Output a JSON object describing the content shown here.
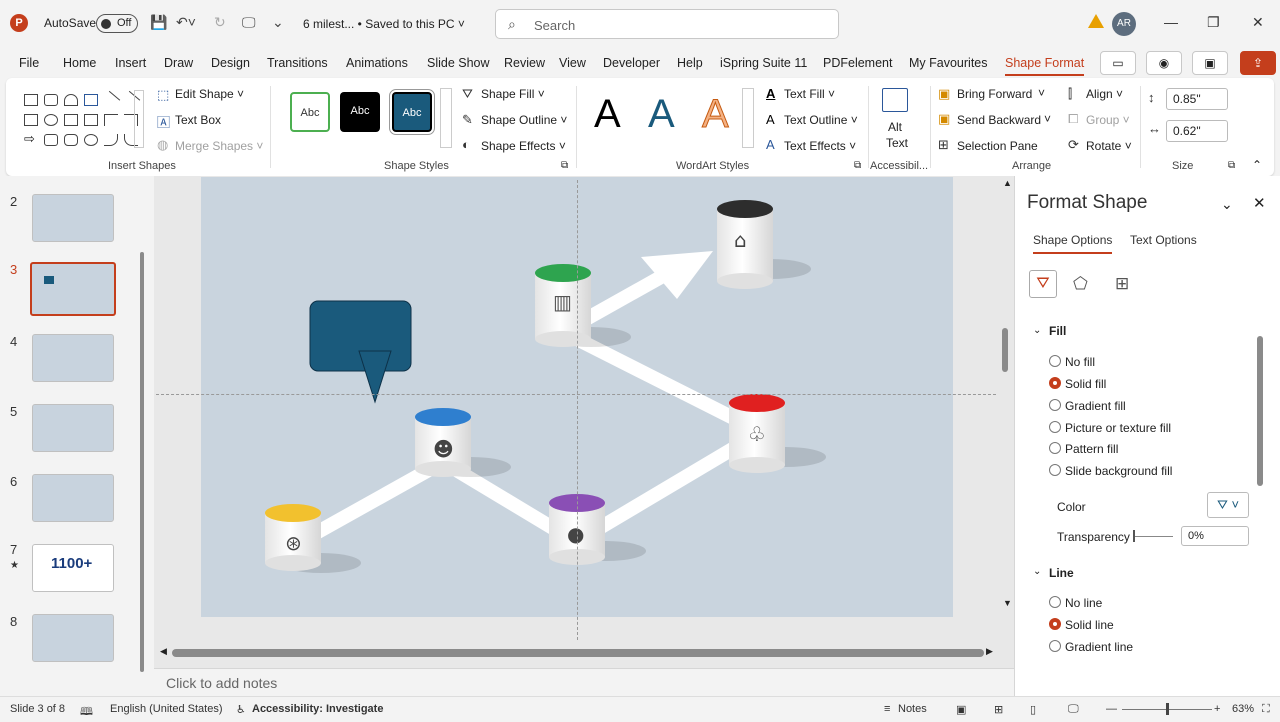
{
  "titlebar": {
    "logo": "P",
    "autosave_label": "AutoSave",
    "autosave_state": "Off",
    "doc_title": "6 milest... • Saved to this PC ˅",
    "search_placeholder": "Search",
    "avatar_initials": "AR",
    "minimize": "—",
    "restore": "❐",
    "close": "✕"
  },
  "tabs": [
    {
      "label": "File"
    },
    {
      "label": "Home"
    },
    {
      "label": "Insert"
    },
    {
      "label": "Draw"
    },
    {
      "label": "Design"
    },
    {
      "label": "Transitions"
    },
    {
      "label": "Animations"
    },
    {
      "label": "Slide Show"
    },
    {
      "label": "Review"
    },
    {
      "label": "View"
    },
    {
      "label": "Developer"
    },
    {
      "label": "Help"
    },
    {
      "label": "iSpring Suite 11"
    },
    {
      "label": "PDFelement"
    },
    {
      "label": "My Favourites"
    },
    {
      "label": "Shape Format"
    }
  ],
  "ribbon": {
    "insert_shapes": {
      "edit_shape": "Edit Shape ˅",
      "text_box": "Text Box",
      "merge_shapes": "Merge Shapes ˅",
      "label": "Insert Shapes"
    },
    "shape_styles": {
      "styles": [
        "Abc",
        "Abc",
        "Abc"
      ],
      "shape_fill": "Shape Fill ˅",
      "shape_outline": "Shape Outline ˅",
      "shape_effects": "Shape Effects ˅",
      "label": "Shape Styles"
    },
    "wordart": {
      "letters": [
        "A",
        "A",
        "A"
      ],
      "text_fill": "Text Fill ˅",
      "text_outline": "Text Outline ˅",
      "text_effects": "Text Effects ˅",
      "label": "WordArt Styles"
    },
    "accessibility": {
      "alt_text_line1": "Alt",
      "alt_text_line2": "Text",
      "label": "Accessibil..."
    },
    "arrange": {
      "bring_forward": "Bring Forward",
      "send_backward": "Send Backward",
      "selection_pane": "Selection Pane",
      "align": "Align ˅",
      "group": "Group ˅",
      "rotate": "Rotate ˅",
      "label": "Arrange"
    },
    "size": {
      "height": "0.85\"",
      "width": "0.62\"",
      "label": "Size"
    }
  },
  "thumbnails": [
    {
      "num": "2"
    },
    {
      "num": "3"
    },
    {
      "num": "4"
    },
    {
      "num": "5"
    },
    {
      "num": "6"
    },
    {
      "num": "7",
      "star": "★",
      "text": "1100+"
    },
    {
      "num": "8"
    }
  ],
  "slide": {
    "colors": {
      "background": "#c9d4de",
      "callout": "#1a5a7c",
      "cyl_yellow": "#f2c12e",
      "cyl_blue": "#2f7fcf",
      "cyl_purple": "#8a4fb5",
      "cyl_green": "#2ea44f",
      "cyl_red": "#e02020",
      "cyl_black": "#2d2d2d"
    },
    "icons": [
      "aperture-icon",
      "brain-head-icon",
      "apple-icon",
      "bar-chart-icon",
      "balloons-icon",
      "bank-icon"
    ]
  },
  "notes": {
    "placeholder": "Click to add notes"
  },
  "format_pane": {
    "title": "Format Shape",
    "tab_shape": "Shape Options",
    "tab_text": "Text Options",
    "fill_section": "Fill",
    "fill_options": [
      "No fill",
      "Solid fill",
      "Gradient fill",
      "Picture or texture fill",
      "Pattern fill",
      "Slide background fill"
    ],
    "fill_selected": "Solid fill",
    "color_label": "Color",
    "transparency_label": "Transparency",
    "transparency_value": "0%",
    "line_section": "Line",
    "line_options": [
      "No line",
      "Solid line",
      "Gradient line"
    ],
    "line_selected": "Solid line"
  },
  "status": {
    "slide_info": "Slide 3 of 8",
    "language": "English (United States)",
    "accessibility": "Accessibility: Investigate",
    "notes": "Notes",
    "zoom": "63%"
  }
}
